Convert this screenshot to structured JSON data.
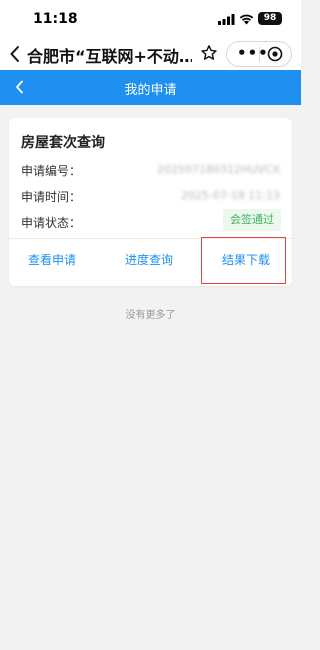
{
  "status_bar": {
    "time": "11:18",
    "battery": "98"
  },
  "wechat_bar": {
    "title": "合肥市“互联网+不动…"
  },
  "header": {
    "title": "我的申请"
  },
  "card": {
    "title": "房屋套次查询",
    "fields": [
      {
        "label": "申请编号：",
        "value": "202507180312HUVCX"
      },
      {
        "label": "申请时间：",
        "value": "2025-07-18 11:13"
      },
      {
        "label": "申请状态：",
        "value": "会签通过"
      }
    ],
    "actions": [
      "查看申请",
      "进度查询",
      "结果下载"
    ]
  },
  "footer": {
    "no_more": "没有更多了"
  },
  "colors": {
    "accent": "#1f8ff0",
    "success": "#40b35c",
    "highlight": "#e8453c"
  }
}
